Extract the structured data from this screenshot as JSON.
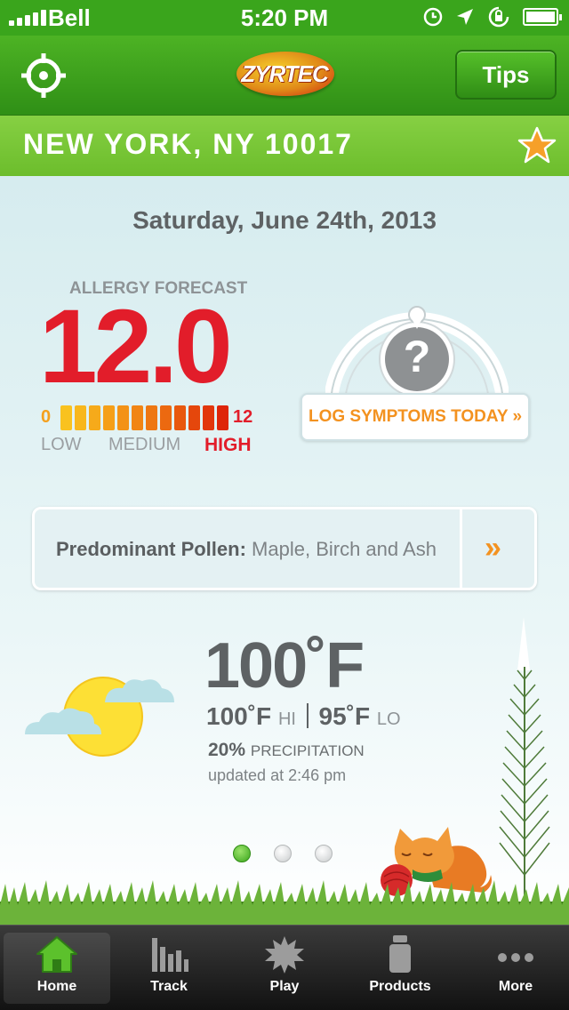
{
  "status_bar": {
    "carrier": "Bell",
    "time": "5:20 PM"
  },
  "nav": {
    "logo_text": "ZYRTEC",
    "tips_label": "Tips"
  },
  "location": {
    "city": "NEW YORK, NY 10017"
  },
  "forecast": {
    "date": "Saturday, June 24th, 2013",
    "label": "ALLERGY FORECAST",
    "value": "12.0",
    "scale_min": "0",
    "scale_max": "12",
    "level_fraction": 1.0,
    "scale_low": "LOW",
    "scale_medium": "MEDIUM",
    "scale_high": "HIGH",
    "bar_colors": [
      "#f9c21f",
      "#f8b71c",
      "#f6aa1a",
      "#f59f18",
      "#f39216",
      "#f18514",
      "#ee7712",
      "#ec6910",
      "#e8580e",
      "#e5470c",
      "#e2360b",
      "#de2509"
    ]
  },
  "symptoms": {
    "button_label": "LOG SYMPTOMS TODAY »",
    "gauge_glyph": "?"
  },
  "pollen": {
    "label": "Predominant Pollen:",
    "value": "Maple, Birch and Ash",
    "chevron": "»"
  },
  "weather": {
    "temp": "100˚F",
    "hi": "100˚F",
    "hi_label": "HI",
    "lo": "95˚F",
    "lo_label": "LO",
    "precip_value": "20%",
    "precip_label": "PRECIPITATION",
    "updated": "updated at 2:46 pm"
  },
  "pager": {
    "pages": 3,
    "active_index": 0
  },
  "tabs": [
    {
      "label": "Home",
      "icon": "home-icon",
      "active": true
    },
    {
      "label": "Track",
      "icon": "bar-chart-icon",
      "active": false
    },
    {
      "label": "Play",
      "icon": "burst-icon",
      "active": false
    },
    {
      "label": "Products",
      "icon": "bottle-icon",
      "active": false
    },
    {
      "label": "More",
      "icon": "ellipsis-icon",
      "active": false
    }
  ],
  "colors": {
    "brand_green": "#3aa51c",
    "alert_red": "#e21d2a",
    "accent_orange": "#f39220"
  }
}
